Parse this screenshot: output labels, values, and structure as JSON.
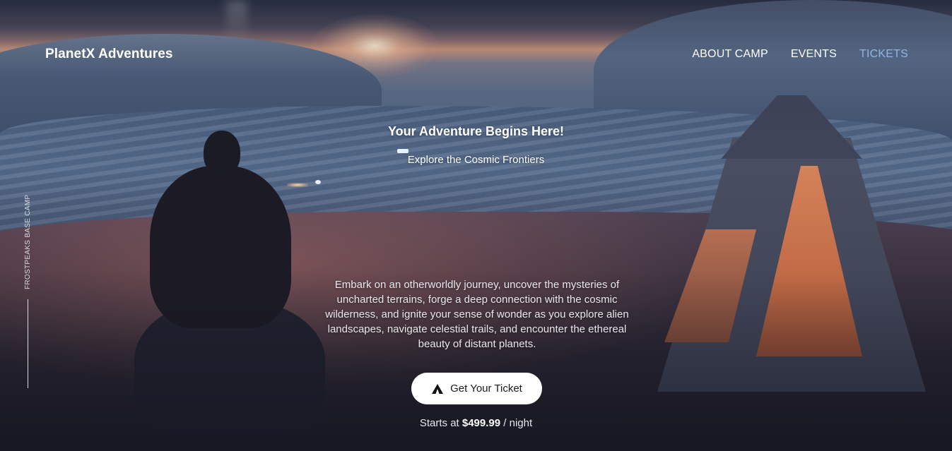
{
  "brand": {
    "name": "PlanetX Adventures"
  },
  "nav": {
    "items": [
      {
        "label": "ABOUT CAMP"
      },
      {
        "label": "EVENTS"
      },
      {
        "label": "TICKETS"
      }
    ],
    "active_index": 2
  },
  "side": {
    "label": "FROSTPEAKS BASE CAMP"
  },
  "hero": {
    "title": "Your Adventure Begins Here!",
    "subtitle": "Explore the Cosmic Frontiers",
    "description": "Embark on an otherworldly journey, uncover the mysteries of uncharted terrains, forge a deep connection with the cosmic wilderness, and ignite your sense of wonder as you explore alien landscapes, navigate celestial trails, and encounter the ethereal beauty of distant planets."
  },
  "cta": {
    "label": "Get Your Ticket",
    "icon": "tent-icon"
  },
  "price": {
    "prefix": "Starts at",
    "amount": "$499.99",
    "suffix": "/ night"
  },
  "colors": {
    "nav_active": "#8fb6e3",
    "cta_bg": "#ffffff",
    "text": "#ffffff"
  }
}
